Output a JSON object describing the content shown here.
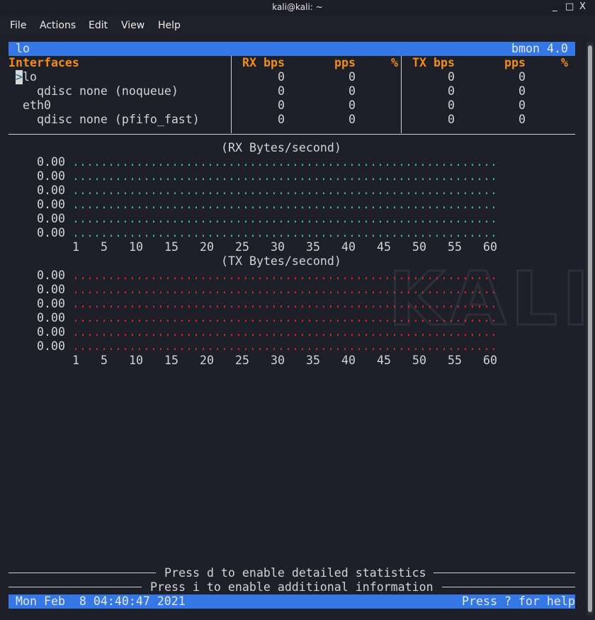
{
  "window": {
    "title": "kali@kali: ~",
    "minimize": "_",
    "maximize": "□",
    "close": "X"
  },
  "menu": [
    "File",
    "Actions",
    "Edit",
    "View",
    "Help"
  ],
  "topbar": {
    "left": "lo",
    "right": "bmon 4.0"
  },
  "watermark": "KALI",
  "table": {
    "headers": {
      "interfaces": "Interfaces",
      "rx_bps": "RX bps",
      "rx_pps": "pps",
      "rx_pct": "%",
      "tx_bps": "TX bps",
      "tx_pps": "pps",
      "tx_pct": "%"
    },
    "cursor": ">",
    "rows": [
      {
        "name": "lo",
        "indent": 2,
        "rx_bps": "0",
        "rx_pps": "0",
        "tx_bps": "0",
        "tx_pps": "0",
        "selected": true
      },
      {
        "name": "qdisc none (noqueue)",
        "indent": 4,
        "rx_bps": "0",
        "rx_pps": "0",
        "tx_bps": "0",
        "tx_pps": "0"
      },
      {
        "name": "eth0",
        "indent": 2,
        "rx_bps": "0",
        "rx_pps": "0",
        "tx_bps": "0",
        "tx_pps": "0"
      },
      {
        "name": "qdisc none (pfifo_fast)",
        "indent": 4,
        "rx_bps": "0",
        "rx_pps": "0",
        "tx_bps": "0",
        "tx_pps": "0"
      }
    ]
  },
  "colors": {
    "rx": "#3fb6a8",
    "tx": "#e0252a",
    "bar": "#3577e4",
    "header": "#f28b1e"
  },
  "chart_data": [
    {
      "type": "scatter",
      "title": "(RX Bytes/second)",
      "y_tick_labels": [
        "0.00",
        "0.00",
        "0.00",
        "0.00",
        "0.00",
        "0.00"
      ],
      "x_tick_labels": [
        "1",
        "5",
        "10",
        "15",
        "20",
        "25",
        "30",
        "35",
        "40",
        "45",
        "50",
        "55",
        "60"
      ],
      "x": [
        1,
        60
      ],
      "values_all": 0,
      "series_color": "#3fb6a8"
    },
    {
      "type": "scatter",
      "title": "(TX Bytes/second)",
      "y_tick_labels": [
        "0.00",
        "0.00",
        "0.00",
        "0.00",
        "0.00",
        "0.00"
      ],
      "x_tick_labels": [
        "1",
        "5",
        "10",
        "15",
        "20",
        "25",
        "30",
        "35",
        "40",
        "45",
        "50",
        "55",
        "60"
      ],
      "x": [
        1,
        60
      ],
      "values_all": 0,
      "series_color": "#e0252a"
    }
  ],
  "footer": {
    "hint_d": "Press d to enable detailed statistics",
    "hint_i": "Press i to enable additional information",
    "datetime": "Mon Feb  8 04:40:47 2021",
    "help": "Press ? for help"
  }
}
